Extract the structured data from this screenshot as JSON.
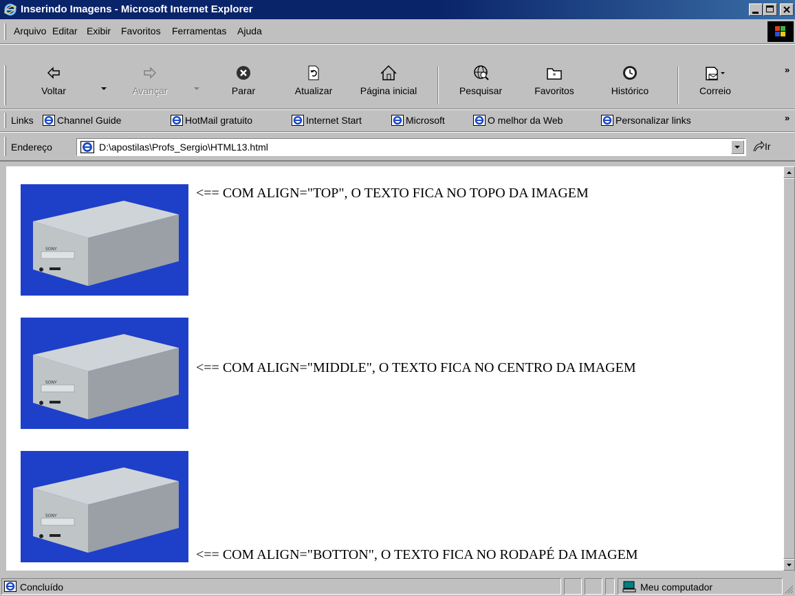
{
  "window": {
    "title": "Inserindo Imagens - Microsoft Internet Explorer"
  },
  "menu": [
    "Arquivo",
    "Editar",
    "Exibir",
    "Favoritos",
    "Ferramentas",
    "Ajuda"
  ],
  "toolbar": {
    "back": "Voltar",
    "forward": "Avançar",
    "stop": "Parar",
    "refresh": "Atualizar",
    "home": "Página inicial",
    "search": "Pesquisar",
    "favorites": "Favoritos",
    "history": "Histórico",
    "mail": "Correio"
  },
  "links": {
    "label": "Links",
    "items": [
      "Channel Guide",
      "HotMail gratuito",
      "Internet Start",
      "Microsoft",
      "O melhor da Web",
      "Personalizar links"
    ]
  },
  "address": {
    "label": "Endereço",
    "value": "D:\\apostilas\\Profs_Sergio\\HTML13.html",
    "go": "Ir"
  },
  "content": {
    "captions": [
      "<== COM ALIGN=\"TOP\", O TEXTO FICA NO TOPO DA IMAGEM",
      "<== COM ALIGN=\"MIDDLE\", O TEXTO FICA NO CENTRO DA IMAGEM",
      "<== COM ALIGN=\"BOTTON\", O TEXTO FICA NO RODAPÉ DA IMAGEM"
    ],
    "image_brand": "SONY"
  },
  "status": {
    "text": "Concluído",
    "zone": "Meu computador"
  },
  "colors": {
    "titlebar": "#0a246a",
    "chrome": "#c0c0c0",
    "image_background": "#1e3fc8"
  }
}
